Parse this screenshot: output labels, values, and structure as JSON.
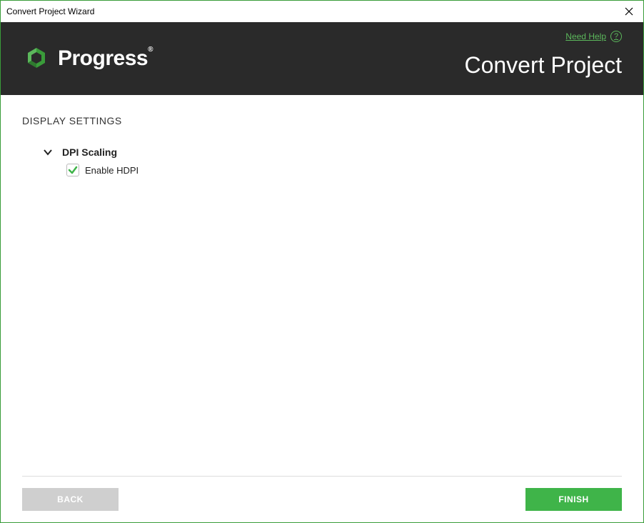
{
  "window": {
    "title": "Convert Project Wizard"
  },
  "header": {
    "brand": "Progress",
    "brand_mark": "®",
    "title": "Convert Project",
    "help_label": "Need Help"
  },
  "section": {
    "title": "DISPLAY SETTINGS"
  },
  "group": {
    "title": "DPI Scaling",
    "expanded": true
  },
  "checkbox": {
    "label": "Enable HDPI",
    "checked": true
  },
  "footer": {
    "back_label": "BACK",
    "finish_label": "FINISH"
  },
  "colors": {
    "accent_green": "#3fb449",
    "header_bg": "#2a2a2a"
  }
}
